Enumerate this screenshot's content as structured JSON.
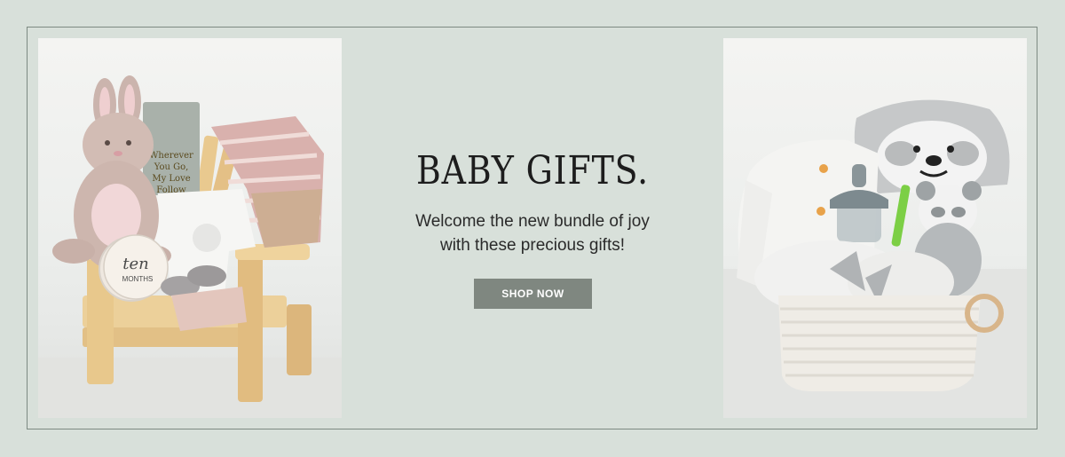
{
  "banner": {
    "title": "BABY GIFTS.",
    "subtitle": "Welcome the new bundle of joy\nwith these precious gifts!",
    "cta_label": "SHOP NOW"
  },
  "images": {
    "left": {
      "subject": "pink bunny plush, striped blanket, milestone cards and onesie on a wooden chair",
      "tag_text": "Wherever You Go, My Love Follow",
      "card_text": "ten months"
    },
    "right": {
      "subject": "sloth themed gift basket with white sweater, sippy cup, panda plush and blanket in a rope basket"
    }
  },
  "colors": {
    "background": "#d8e0da",
    "frame": "#7d8a82",
    "button": "#7f8780",
    "title": "#1d1d1d"
  }
}
